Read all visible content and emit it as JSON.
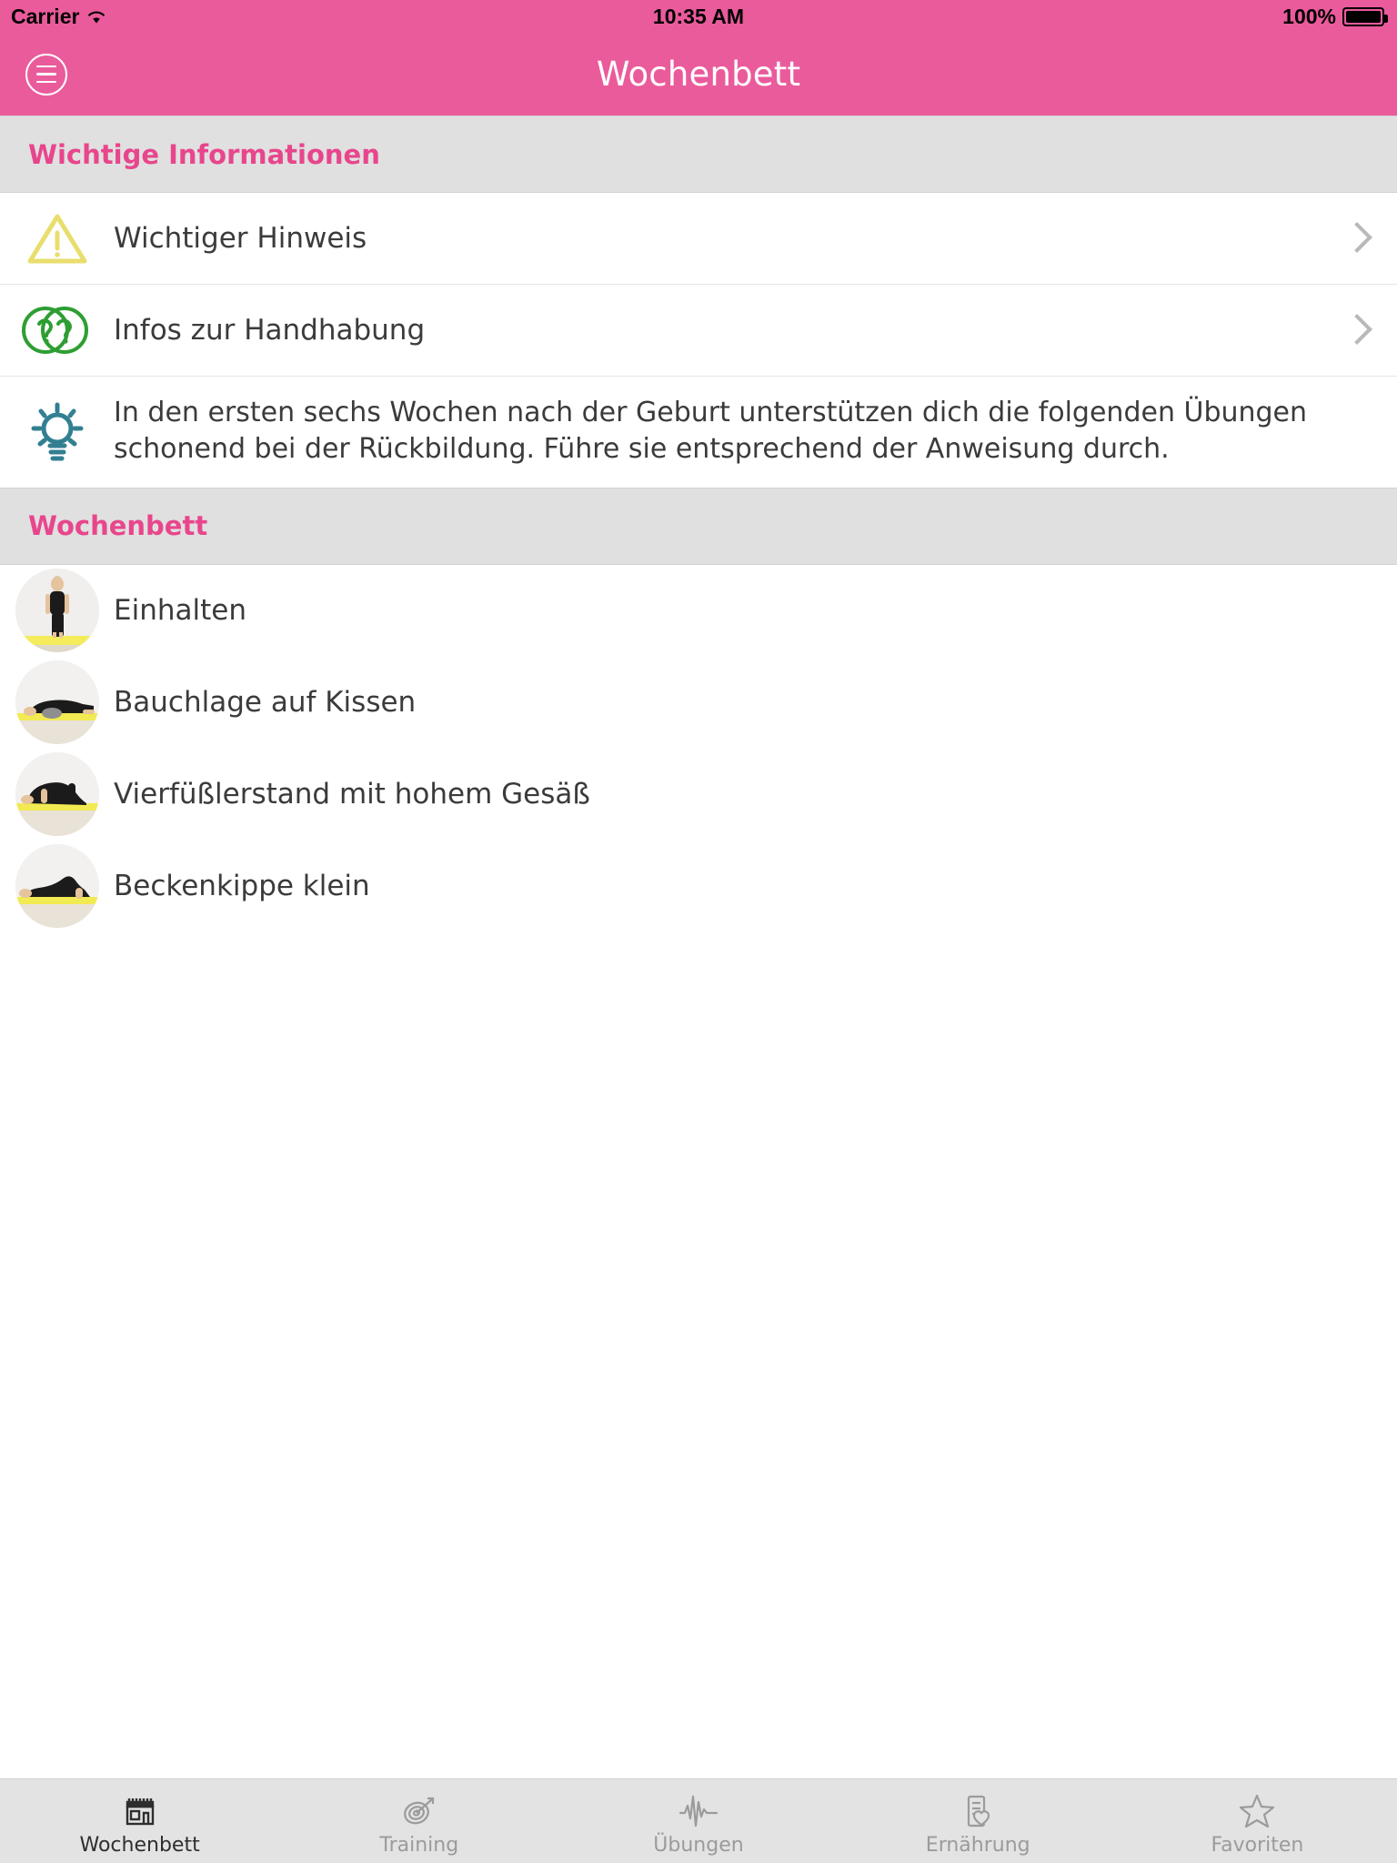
{
  "status_bar": {
    "carrier": "Carrier",
    "time": "10:35 AM",
    "battery": "100%",
    "wifi_icon": "wifi-icon",
    "battery_icon": "battery-icon"
  },
  "nav": {
    "title": "Wochenbett",
    "menu_icon": "hamburger-menu-icon",
    "background_color": "#ea5b9c",
    "title_color": "#ffffff"
  },
  "sections": [
    {
      "header": "Wichtige Informationen",
      "header_color": "#e8468c",
      "rows": [
        {
          "label": "Wichtiger Hinweis",
          "icon": "warning-triangle-icon",
          "icon_color": "#eadf6e",
          "has_chevron": true
        },
        {
          "label": "Infos zur Handhabung",
          "icon": "double-question-mark-icon",
          "icon_color": "#2e9e33",
          "has_chevron": true
        }
      ],
      "info": {
        "icon": "lightbulb-icon",
        "icon_color": "#337f92",
        "text": "In den ersten sechs Wochen nach der Geburt unterstützen dich die folgenden Übungen schonend bei der Rückbildung. Führe sie entsprechend der Anweisung durch."
      }
    },
    {
      "header": "Wochenbett",
      "header_color": "#e8468c",
      "exercises": [
        {
          "label": "Einhalten",
          "thumb": "standing-woman-thumbnail"
        },
        {
          "label": "Bauchlage auf Kissen",
          "thumb": "prone-on-pillow-thumbnail"
        },
        {
          "label": "Vierfüßlerstand mit hohem Gesäß",
          "thumb": "quadruped-high-hips-thumbnail"
        },
        {
          "label": "Beckenkippe klein",
          "thumb": "pelvic-tilt-thumbnail"
        }
      ]
    }
  ],
  "tabbar": {
    "active_index": 0,
    "tabs": [
      {
        "label": "Wochenbett",
        "icon": "postpartum-bed-icon"
      },
      {
        "label": "Training",
        "icon": "target-dart-icon"
      },
      {
        "label": "Übungen",
        "icon": "pulse-wave-icon"
      },
      {
        "label": "Ernährung",
        "icon": "document-heart-icon"
      },
      {
        "label": "Favoriten",
        "icon": "star-icon"
      }
    ]
  }
}
